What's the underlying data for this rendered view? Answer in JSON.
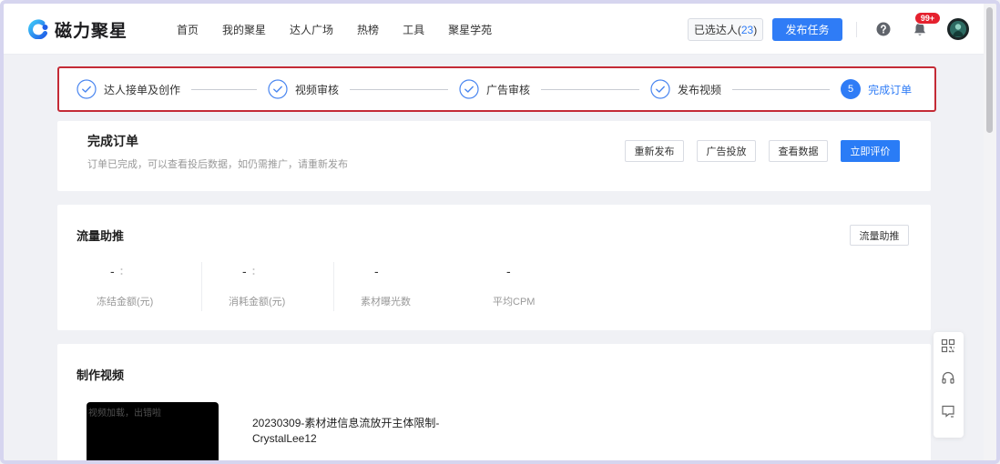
{
  "header": {
    "logo": {
      "text": "磁力聚星",
      "icon": "logo-swirl"
    },
    "nav": [
      {
        "label": "首页"
      },
      {
        "label": "我的聚星"
      },
      {
        "label": "达人广场"
      },
      {
        "label": "热榜"
      },
      {
        "label": "工具"
      },
      {
        "label": "聚星学苑"
      }
    ],
    "selected_creators": {
      "label": "已选达人",
      "count": "23"
    },
    "publish_button": "发布任务",
    "help_icon": "question-circle",
    "notifications": {
      "icon": "bell",
      "badge": "99+"
    },
    "avatar_icon": "user-avatar"
  },
  "steps": [
    {
      "label": "达人接单及创作",
      "done": true
    },
    {
      "label": "视频审核",
      "done": true
    },
    {
      "label": "广告审核",
      "done": true
    },
    {
      "label": "发布视频",
      "done": true
    },
    {
      "label": "完成订单",
      "done": false,
      "number": "5"
    }
  ],
  "order_status": {
    "title": "完成订单",
    "description": "订单已完成，可以查看投后数据，如仍需推广，请重新发布",
    "actions": [
      {
        "label": "重新发布",
        "primary": false
      },
      {
        "label": "广告投放",
        "primary": false
      },
      {
        "label": "查看数据",
        "primary": false
      },
      {
        "label": "立即评价",
        "primary": true
      }
    ]
  },
  "traffic_boost": {
    "title": "流量助推",
    "button": "流量助推",
    "stats": [
      {
        "value": "-",
        "label": "冻结金额(元)",
        "icon": "more-dots"
      },
      {
        "value": "-",
        "label": "消耗金额(元)",
        "icon": "more-dots"
      },
      {
        "value": "-",
        "label": "素材曝光数"
      },
      {
        "value": "-",
        "label": "平均CPM"
      }
    ]
  },
  "video_production": {
    "title": "制作视频",
    "thumbnail_message": "视频加载，出错啦",
    "video_name_lines": [
      "20230309-素材进信息流放开主体限制-",
      "CrystalLee12"
    ]
  },
  "float_toolbar": {
    "icons": [
      "qrcode",
      "headset",
      "feedback"
    ]
  },
  "colors": {
    "accent": "#2f7cf6",
    "highlight_border": "#c42b36",
    "badge": "#e5212e",
    "page_background": "#f0f1f5"
  }
}
